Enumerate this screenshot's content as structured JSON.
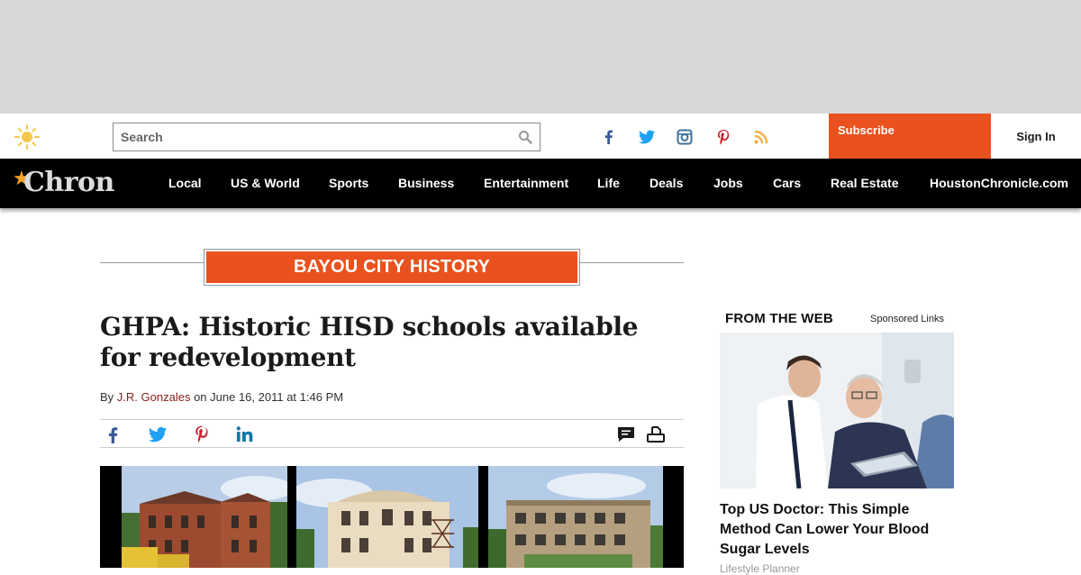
{
  "header": {
    "search_placeholder": "Search",
    "subscribe_label": "Subscribe",
    "signin_label": "Sign In",
    "social_icons": [
      "facebook-icon",
      "twitter-icon",
      "instagram-icon",
      "pinterest-icon",
      "rss-icon"
    ],
    "brand_color": "#e9521e"
  },
  "nav": {
    "logo_text": "Chron",
    "items": [
      "Local",
      "US & World",
      "Sports",
      "Business",
      "Entertainment",
      "Life",
      "Deals",
      "Jobs",
      "Cars",
      "Real Estate",
      "HoustonChronicle.com"
    ]
  },
  "article": {
    "section": "BAYOU CITY HISTORY",
    "headline": "GHPA: Historic HISD schools available for redevelopment",
    "byline_prefix": "By",
    "author": "J.R. Gonzales",
    "byline_date": "on June 16, 2011 at 1:46 PM",
    "share_icons": [
      "facebook-icon",
      "twitter-icon",
      "pinterest-icon",
      "linkedin-icon",
      "comment-icon",
      "print-icon"
    ]
  },
  "sidebar": {
    "title": "FROM THE WEB",
    "sponsored_label": "Sponsored Links",
    "promo_headline": "Top US Doctor: This Simple Method Can Lower Your Blood Sugar Levels",
    "promo_source": "Lifestyle Planner"
  }
}
